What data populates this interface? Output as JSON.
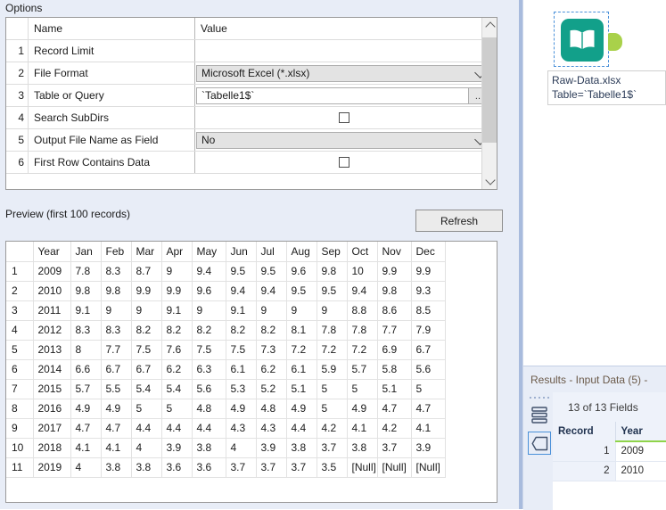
{
  "config_panel": {
    "options_label": "Options",
    "preview_label": "Preview (first 100 records)",
    "refresh_label": "Refresh",
    "options_columns": {
      "name": "Name",
      "value": "Value"
    },
    "options_rows": [
      {
        "index": "1",
        "name": "Record Limit",
        "kind": "text-blank",
        "value": ""
      },
      {
        "index": "2",
        "name": "File Format",
        "kind": "combo",
        "value": "Microsoft Excel (*.xlsx)"
      },
      {
        "index": "3",
        "name": "Table or Query",
        "kind": "textbox",
        "value": "`Tabelle1$`",
        "button": "..."
      },
      {
        "index": "4",
        "name": "Search SubDirs",
        "kind": "checkbox",
        "value": ""
      },
      {
        "index": "5",
        "name": "Output File Name as Field",
        "kind": "combo",
        "value": "No"
      },
      {
        "index": "6",
        "name": "First Row Contains Data",
        "kind": "checkbox",
        "value": ""
      }
    ]
  },
  "preview_table": {
    "columns": [
      "",
      "Year",
      "Jan",
      "Feb",
      "Mar",
      "Apr",
      "May",
      "Jun",
      "Jul",
      "Aug",
      "Sep",
      "Oct",
      "Nov",
      "Dec"
    ],
    "rows": [
      {
        "n": "1",
        "cells": [
          "2009",
          "7.8",
          "8.3",
          "8.7",
          "9",
          "9.4",
          "9.5",
          "9.5",
          "9.6",
          "9.8",
          "10",
          "9.9",
          "9.9"
        ]
      },
      {
        "n": "2",
        "cells": [
          "2010",
          "9.8",
          "9.8",
          "9.9",
          "9.9",
          "9.6",
          "9.4",
          "9.4",
          "9.5",
          "9.5",
          "9.4",
          "9.8",
          "9.3"
        ]
      },
      {
        "n": "3",
        "cells": [
          "2011",
          "9.1",
          "9",
          "9",
          "9.1",
          "9",
          "9.1",
          "9",
          "9",
          "9",
          "8.8",
          "8.6",
          "8.5"
        ]
      },
      {
        "n": "4",
        "cells": [
          "2012",
          "8.3",
          "8.3",
          "8.2",
          "8.2",
          "8.2",
          "8.2",
          "8.2",
          "8.1",
          "7.8",
          "7.8",
          "7.7",
          "7.9"
        ]
      },
      {
        "n": "5",
        "cells": [
          "2013",
          "8",
          "7.7",
          "7.5",
          "7.6",
          "7.5",
          "7.5",
          "7.3",
          "7.2",
          "7.2",
          "7.2",
          "6.9",
          "6.7"
        ]
      },
      {
        "n": "6",
        "cells": [
          "2014",
          "6.6",
          "6.7",
          "6.7",
          "6.2",
          "6.3",
          "6.1",
          "6.2",
          "6.1",
          "5.9",
          "5.7",
          "5.8",
          "5.6"
        ]
      },
      {
        "n": "7",
        "cells": [
          "2015",
          "5.7",
          "5.5",
          "5.4",
          "5.4",
          "5.6",
          "5.3",
          "5.2",
          "5.1",
          "5",
          "5",
          "5.1",
          "5"
        ]
      },
      {
        "n": "8",
        "cells": [
          "2016",
          "4.9",
          "4.9",
          "5",
          "5",
          "4.8",
          "4.9",
          "4.8",
          "4.9",
          "5",
          "4.9",
          "4.7",
          "4.7"
        ]
      },
      {
        "n": "9",
        "cells": [
          "2017",
          "4.7",
          "4.7",
          "4.4",
          "4.4",
          "4.4",
          "4.3",
          "4.3",
          "4.4",
          "4.2",
          "4.1",
          "4.2",
          "4.1"
        ]
      },
      {
        "n": "10",
        "cells": [
          "2018",
          "4.1",
          "4.1",
          "4",
          "3.9",
          "3.8",
          "4",
          "3.9",
          "3.8",
          "3.7",
          "3.8",
          "3.7",
          "3.9"
        ]
      },
      {
        "n": "11",
        "cells": [
          "2019",
          "4",
          "3.8",
          "3.8",
          "3.6",
          "3.6",
          "3.7",
          "3.7",
          "3.7",
          "3.5",
          "[Null]",
          "[Null]",
          "[Null]"
        ]
      }
    ]
  },
  "canvas": {
    "node": {
      "icon_name": "input-data-book-icon",
      "icon_color": "#12a08a",
      "anchor_color": "#a9d14a",
      "label_line1": "Raw-Data.xlsx",
      "label_line2": "Table=`Tabelle1$`"
    }
  },
  "results": {
    "title": "Results - Input Data (5) -",
    "fields_summary": "13 of 13 Fields",
    "columns": [
      "Record",
      "Year"
    ],
    "rows": [
      {
        "record": "1",
        "year": "2009"
      },
      {
        "record": "2",
        "year": "2010"
      }
    ]
  }
}
